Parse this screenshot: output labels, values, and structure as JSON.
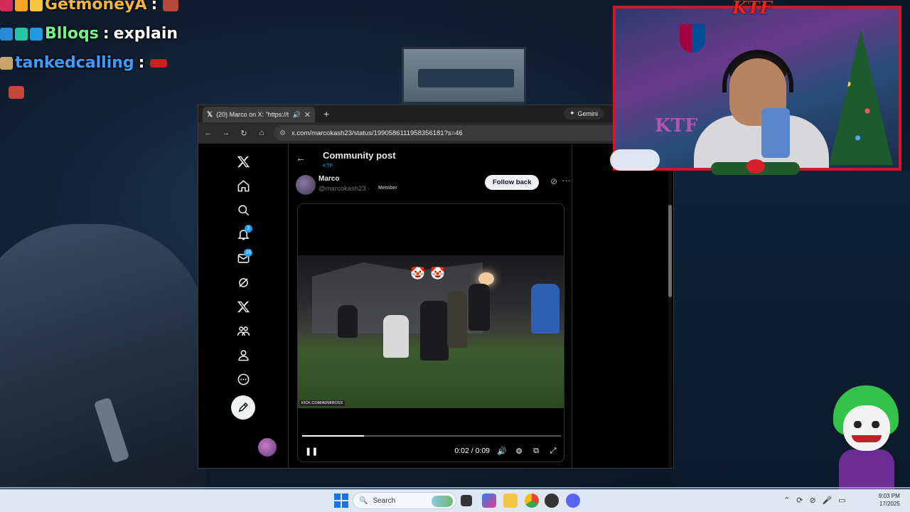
{
  "chat": {
    "lines": [
      {
        "username": "GetmoneyA",
        "separator": ":",
        "message": ""
      },
      {
        "username": "Blloqs",
        "separator": ":",
        "message": "explain"
      },
      {
        "username": "tankedcalling",
        "separator": ":",
        "message": ""
      }
    ]
  },
  "browser": {
    "tab_title": "(20) Marco on X: \"https://t...",
    "new_tab": "+",
    "gemini_label": "Gemini",
    "url": "x.com/marcokash23/status/1990586111958356181?s=46"
  },
  "x": {
    "header_title": "Community post",
    "header_sub": "KTF",
    "notifications_count": "2",
    "messages_count": "16",
    "author_name": "Marco",
    "author_handle": "@marcokash23 ·",
    "member_badge": "Member",
    "follow_label": "Follow back",
    "video": {
      "watermark": "KICK.COM/ADMIROSS",
      "time": "0:02 / 0:09",
      "progress": 0.24
    }
  },
  "webcam": {
    "logo": "KTF",
    "room_text": "KTF"
  },
  "taskbar": {
    "search_placeholder": "Search",
    "time": "9:03 PM",
    "date": "17/2025"
  },
  "colors": {
    "chat_user_1": "#f3b53b",
    "chat_user_2": "#7cf08a",
    "chat_user_3": "#3f9bff",
    "x_accent": "#1d9bf0",
    "cam_border": "#c71b2a"
  },
  "icons": [
    "x-logo-icon",
    "home-icon",
    "search-icon",
    "bell-icon",
    "mail-icon",
    "grok-icon",
    "premium-icon",
    "communities-icon",
    "profile-icon",
    "more-icon",
    "post-icon",
    "pause-icon",
    "volume-icon",
    "settings-icon",
    "pip-icon",
    "fullscreen-icon"
  ]
}
